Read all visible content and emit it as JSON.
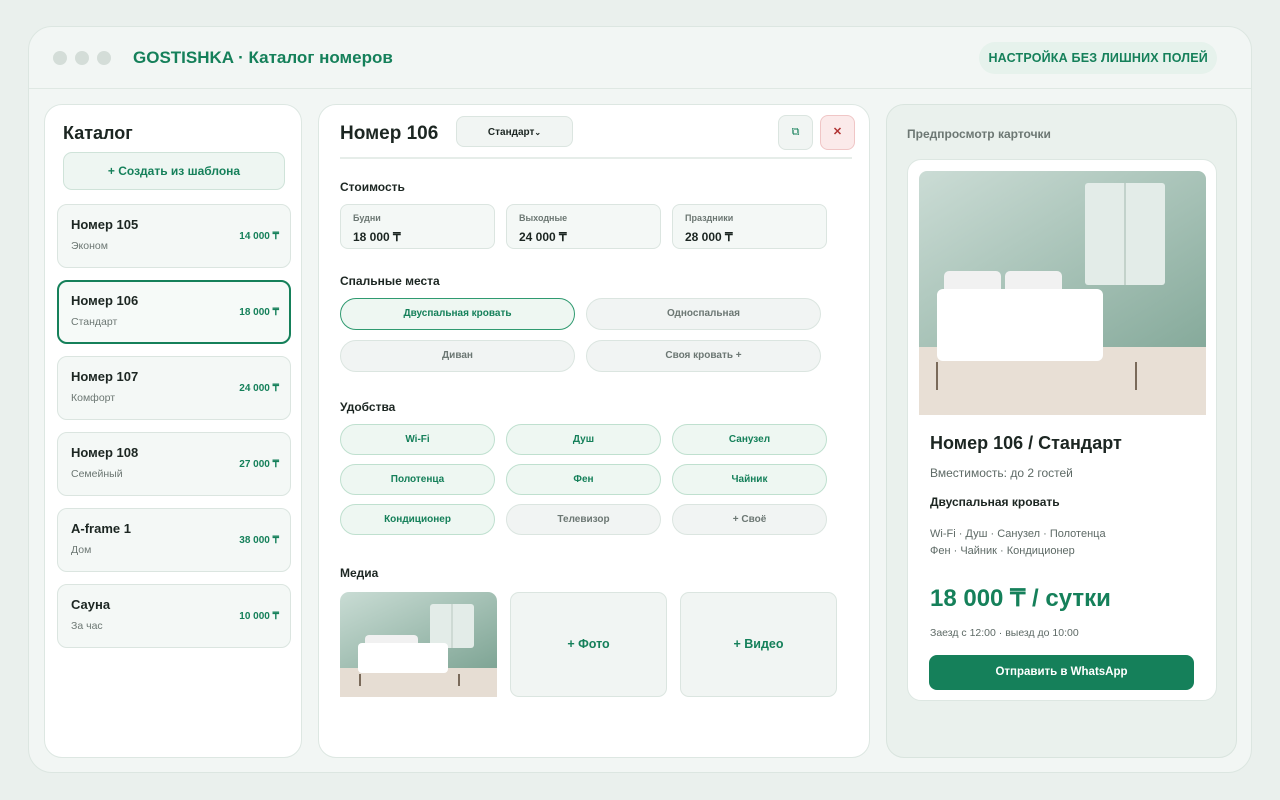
{
  "app": {
    "title": "GOSTISHKA · Каталог номеров",
    "badge": "НАСТРОЙКА БЕЗ ЛИШНИХ ПОЛЕЙ"
  },
  "catalog": {
    "title": "Каталог",
    "create_label": "+ Создать из шаблона",
    "rooms": [
      {
        "name": "Номер 105",
        "type": "Эконом",
        "price": "14 000 ₸",
        "active": false
      },
      {
        "name": "Номер 106",
        "type": "Стандарт",
        "price": "18 000 ₸",
        "active": true
      },
      {
        "name": "Номер 107",
        "type": "Комфорт",
        "price": "24 000 ₸",
        "active": false
      },
      {
        "name": "Номер 108",
        "type": "Семейный",
        "price": "27 000 ₸",
        "active": false
      },
      {
        "name": "A-frame 1",
        "type": "Дом",
        "price": "38 000 ₸",
        "active": false
      },
      {
        "name": "Сауна",
        "type": "За час",
        "price": "10 000 ₸",
        "active": false
      }
    ]
  },
  "editor": {
    "title": "Номер 106",
    "type_select": "Стандарт",
    "copy_icon": "copy-icon",
    "delete_icon": "close-icon",
    "sections": {
      "price": "Стоимость",
      "beds": "Спальные места",
      "amenities": "Удобства",
      "media": "Медиа"
    },
    "prices": [
      {
        "label": "Будни",
        "value": "18 000 ₸"
      },
      {
        "label": "Выходные",
        "value": "24 000 ₸"
      },
      {
        "label": "Праздники",
        "value": "28 000 ₸"
      }
    ],
    "beds": [
      {
        "label": "Двуспальная кровать",
        "selected": true
      },
      {
        "label": "Односпальная",
        "selected": false
      },
      {
        "label": "Диван",
        "selected": false
      },
      {
        "label": "Своя кровать +",
        "selected": false
      }
    ],
    "amenities": [
      {
        "label": "Wi-Fi",
        "on": true
      },
      {
        "label": "Душ",
        "on": true
      },
      {
        "label": "Санузел",
        "on": true
      },
      {
        "label": "Полотенца",
        "on": true
      },
      {
        "label": "Фен",
        "on": true
      },
      {
        "label": "Чайник",
        "on": true
      },
      {
        "label": "Кондиционер",
        "on": true
      },
      {
        "label": "Телевизор",
        "on": false
      },
      {
        "label": "+ Своё",
        "on": false
      }
    ],
    "media": {
      "add_photo": "+ Фото",
      "add_video": "+ Видео"
    }
  },
  "preview": {
    "label": "Предпросмотр карточки",
    "title": "Номер 106 / Стандарт",
    "capacity": "Вместимость: до 2 гостей",
    "bed": "Двуспальная кровать",
    "amenities_line1": "Wi-Fi · Душ · Санузел · Полотенца",
    "amenities_line2": "Фен · Чайник · Кондиционер",
    "price": "18 000 ₸ / сутки",
    "checkin": "Заезд с 12:00 · выезд до 10:00",
    "whatsapp_label": "Отправить в WhatsApp"
  },
  "colors": {
    "accent": "#15805a",
    "danger": "#b03232",
    "background": "#eaf0ed"
  }
}
